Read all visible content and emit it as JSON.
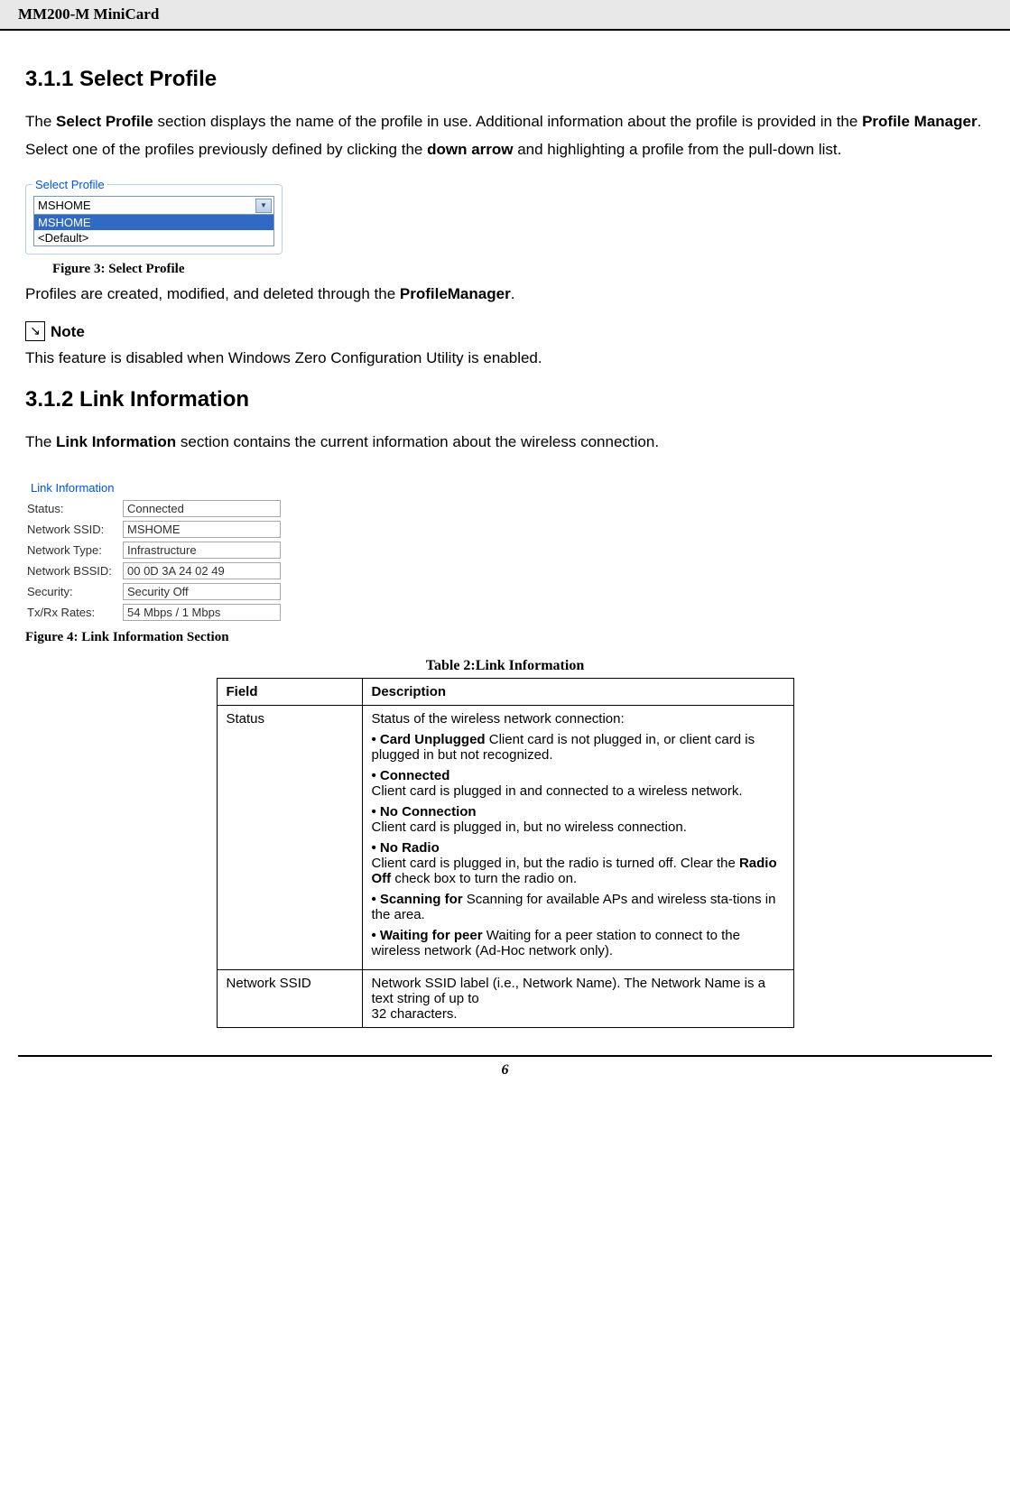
{
  "header": {
    "title": "MM200-M MiniCard"
  },
  "section311": {
    "heading": "3.1.1 Select Profile",
    "para1_pre": "The ",
    "para1_b1": "Select Profile",
    "para1_mid": " section displays the name of the profile in use. Additional information about the profile is provided in the ",
    "para1_b2": "Profile Manager",
    "para1_post": ".",
    "para2_pre": "Select one of the profiles previously defined by clicking the ",
    "para2_b1": "down arrow",
    "para2_post": " and highlighting a profile from the pull-down list."
  },
  "selectProfileDropdown": {
    "groupLabel": "Select Profile",
    "selected": "MSHOME",
    "highlighted": "MSHOME",
    "default": "<Default>"
  },
  "figure3Caption": "Figure 3: Select Profile",
  "profilesSentence_pre": "Profiles are created, modified, and deleted through the ",
  "profilesSentence_b": "ProfileManager",
  "profilesSentence_post": ".",
  "note": {
    "label": "Note",
    "text": "This feature is disabled when Windows Zero Configuration Utility is enabled."
  },
  "section312": {
    "heading": "3.1.2 Link Information",
    "para1_pre": "The ",
    "para1_b1": "Link Information",
    "para1_post": " section contains the current information about the wireless connection."
  },
  "linkInfoGroup": {
    "groupLabel": "Link Information",
    "rows": {
      "status_label": "Status:",
      "status_value": "Connected",
      "ssid_label": "Network SSID:",
      "ssid_value": "MSHOME",
      "type_label": "Network Type:",
      "type_value": "Infrastructure",
      "bssid_label": "Network BSSID:",
      "bssid_value": "00 0D 3A 24 02 49",
      "security_label": "Security:",
      "security_value": "Security Off",
      "rates_label": "Tx/Rx Rates:",
      "rates_value": "54 Mbps / 1 Mbps"
    }
  },
  "figure4Caption": "Figure 4: Link Information Section",
  "table2": {
    "caption": "Table 2:Link Information",
    "header_field": "Field",
    "header_desc": "Description",
    "status_field": "Status",
    "status_intro": "Status of the wireless network connection:",
    "card_unplugged_b": "• Card Unplugged",
    "card_unplugged_t": " Client card is not plugged in, or client card is plugged in but not recognized.",
    "connected_b": "• Connected",
    "connected_t": "Client card is plugged in and connected to a wireless network.",
    "noconn_b": "• No Connection",
    "noconn_t": "Client card is plugged in, but no wireless connection.",
    "noradio_b": "• No Radio",
    "noradio_t_pre": "Client card is plugged in, but the radio is turned off. Clear the ",
    "noradio_t_b": "Radio Off",
    "noradio_t_post": " check box to turn the radio on.",
    "scanning_b": "• Scanning for",
    "scanning_t": " Scanning for available APs and wireless sta-tions in the area.",
    "waiting_b": "• Waiting for peer",
    "waiting_t": " Waiting for a peer station to connect to the wireless network (Ad-Hoc network only).",
    "ssid_field": "Network SSID",
    "ssid_desc": "Network SSID label (i.e., Network Name). The Network Name is a text string of up to\n32 characters."
  },
  "pageNumber": "6"
}
